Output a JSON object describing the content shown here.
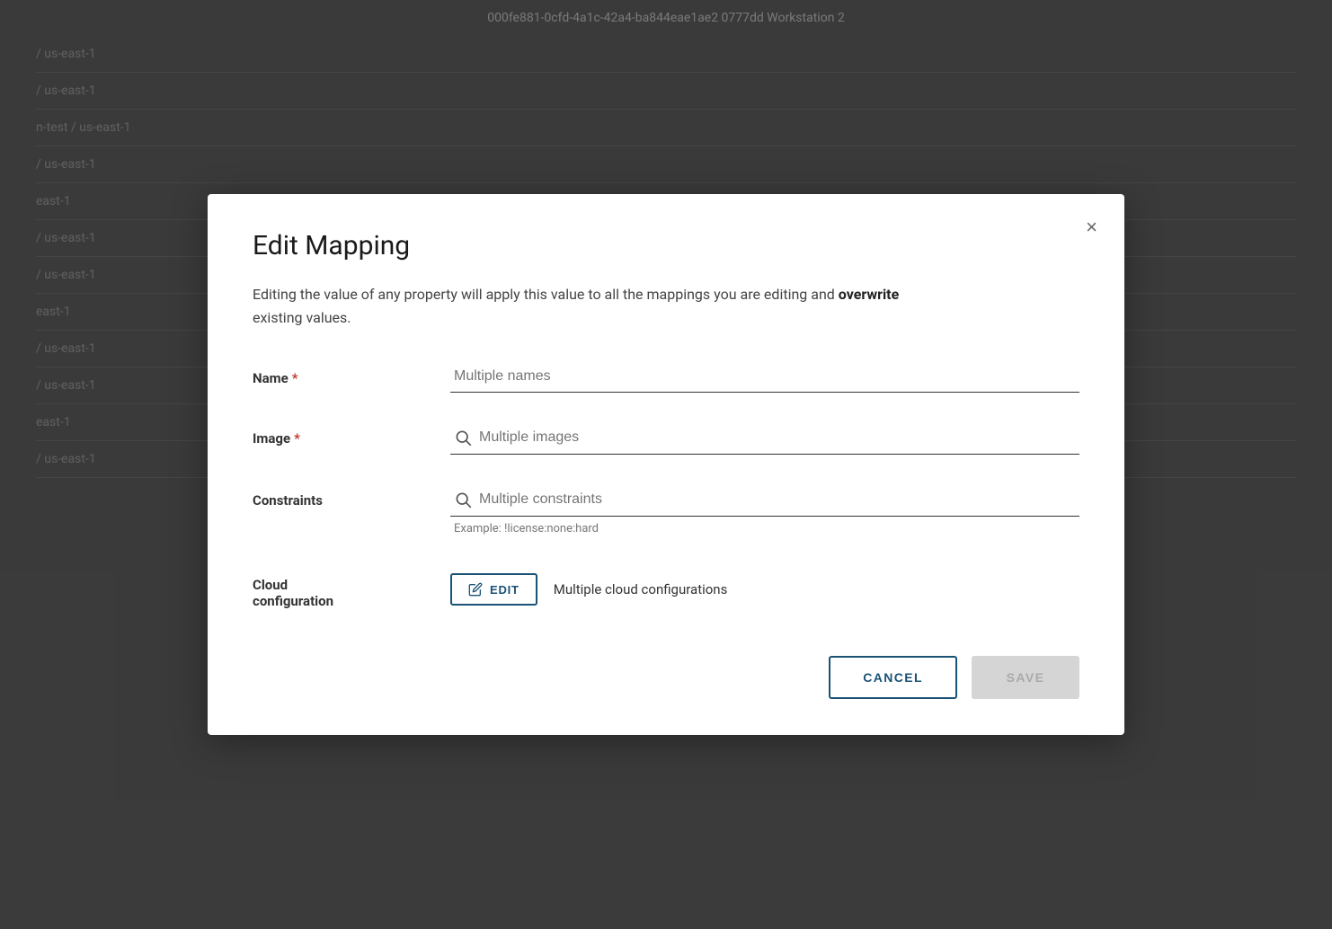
{
  "background": {
    "header_text": "000fe881-0cfd-4a1c-42a4-ba844eae1ae2 0777dd Workstation 2",
    "rows": [
      "/ us-east-1",
      "/ us-east-1",
      "n-test / us-east-1",
      "/ us-east-1",
      "east-1",
      "/ us-east-1",
      "/ us-east-1",
      "east-1",
      "/ us-east-1",
      "/ us-east-1",
      "east-1",
      "/ us-east-1"
    ]
  },
  "modal": {
    "title": "Edit Mapping",
    "description_part1": "Editing the value of any property will apply this value to all the mappings you are editing and ",
    "description_bold": "overwrite",
    "description_part2": " existing values.",
    "close_label": "×",
    "fields": {
      "name": {
        "label": "Name",
        "required": true,
        "placeholder": "Multiple names"
      },
      "image": {
        "label": "Image",
        "required": true,
        "placeholder": "Multiple images"
      },
      "constraints": {
        "label": "Constraints",
        "required": false,
        "placeholder": "Multiple constraints",
        "hint": "Example: !license:none:hard"
      },
      "cloud_config": {
        "label_line1": "Cloud",
        "label_line2": "configuration",
        "edit_button_label": "EDIT",
        "value_text": "Multiple cloud configurations"
      }
    },
    "footer": {
      "cancel_label": "CANCEL",
      "save_label": "SAVE"
    }
  },
  "icons": {
    "close": "×",
    "search": "search-icon",
    "pencil": "pencil-icon"
  }
}
